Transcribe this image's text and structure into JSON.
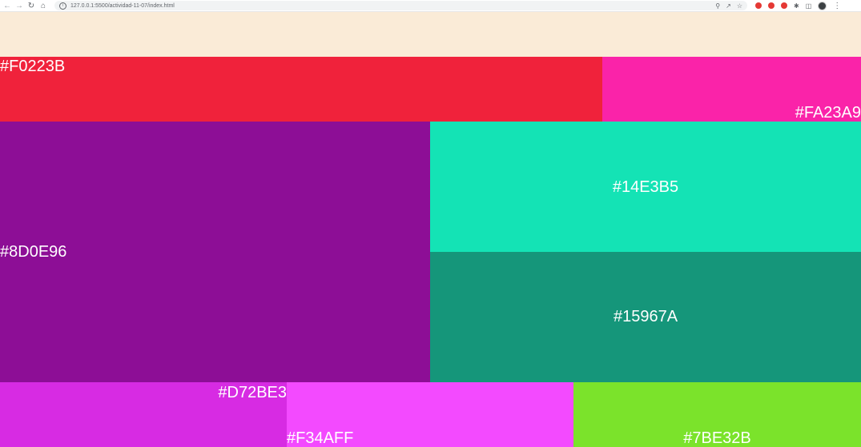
{
  "browser": {
    "url": "127.0.0.1:5500/actividad-11-07/index.html",
    "ext_colors": [
      "#e53935",
      "#e53935",
      "#e53935"
    ]
  },
  "blocks": {
    "f0223b": {
      "label": "#F0223B",
      "color": "#F0223B"
    },
    "fa23a9": {
      "label": "#FA23A9",
      "color": "#FA23A9"
    },
    "8d0e96": {
      "label": "#8D0E96",
      "color": "#8D0E96"
    },
    "14e3b5": {
      "label": "#14E3B5",
      "color": "#14E3B5"
    },
    "15967a": {
      "label": "#15967A",
      "color": "#15967A"
    },
    "d72be3": {
      "label": "#D72BE3",
      "color": "#D72BE3"
    },
    "f34aff": {
      "label": "#F34AFF",
      "color": "#F34AFF"
    },
    "7be32b": {
      "label": "#7BE32B",
      "color": "#7BE32B"
    }
  },
  "header": {
    "color": "#FAEBD7"
  }
}
